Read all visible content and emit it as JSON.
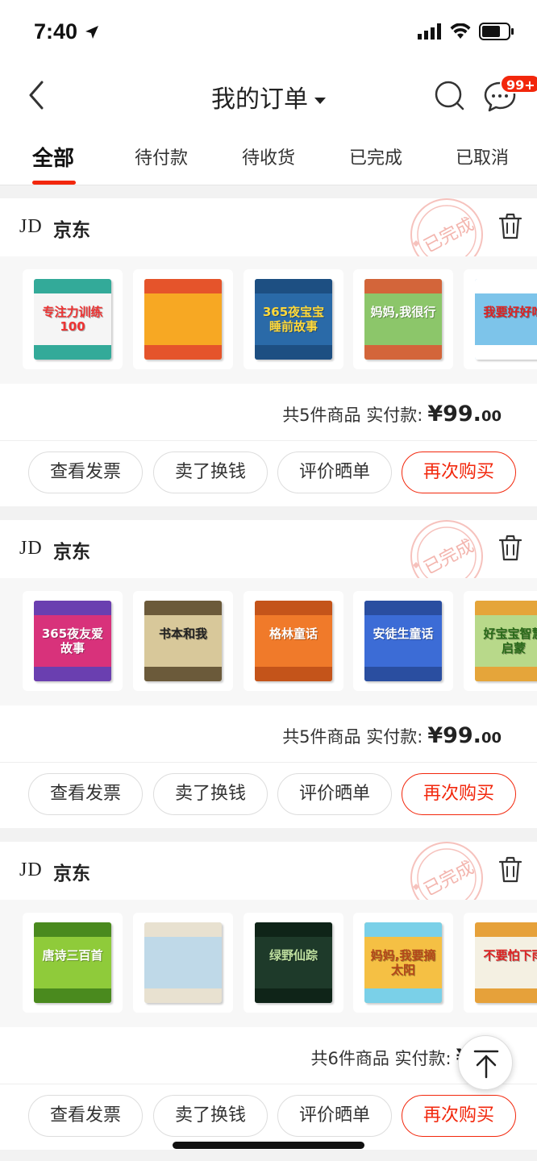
{
  "status_bar": {
    "time": "7:40"
  },
  "header": {
    "title": "我的订单",
    "badge": "99+"
  },
  "tabs": [
    {
      "label": "全部",
      "active": true
    },
    {
      "label": "待付款",
      "active": false
    },
    {
      "label": "待收货",
      "active": false
    },
    {
      "label": "已完成",
      "active": false
    },
    {
      "label": "已取消",
      "active": false
    }
  ],
  "orders": [
    {
      "shop_logo": "JD",
      "shop": "京东",
      "stamp": "已完成",
      "summary": "共5件商品 实付款:",
      "price_main": "¥99.",
      "price_cents": "00",
      "books": [
        {
          "title": "专注力训练100",
          "color": "#f5f5f5",
          "text_color": "#e33",
          "stripe": "#3a9"
        },
        {
          "title": "",
          "color": "#f7a823",
          "text_color": "#fff",
          "stripe": "#e5542b"
        },
        {
          "title": "365夜宝宝睡前故事",
          "color": "#2a6aa8",
          "text_color": "#ffd83a",
          "stripe": "#1d4f82"
        },
        {
          "title": "妈妈,我很行",
          "color": "#8cc66a",
          "text_color": "#fff",
          "stripe": "#d3653a"
        },
        {
          "title": "我要好好吃",
          "color": "#7dc4ea",
          "text_color": "#d22",
          "stripe": "#fff"
        }
      ],
      "buttons": [
        "查看发票",
        "卖了换钱",
        "评价晒单",
        "再次购买"
      ]
    },
    {
      "shop_logo": "JD",
      "shop": "京东",
      "stamp": "已完成",
      "summary": "共5件商品 实付款:",
      "price_main": "¥99.",
      "price_cents": "00",
      "books": [
        {
          "title": "365夜友爱故事",
          "color": "#d8327b",
          "text_color": "#fff",
          "stripe": "#6a3fb0"
        },
        {
          "title": "书本和我",
          "color": "#d8c89a",
          "text_color": "#222",
          "stripe": "#6b5a3a"
        },
        {
          "title": "格林童话",
          "color": "#f07a2a",
          "text_color": "#fff",
          "stripe": "#c4541a"
        },
        {
          "title": "安徒生童话",
          "color": "#3c6cd6",
          "text_color": "#fff",
          "stripe": "#2a4ea0"
        },
        {
          "title": "好宝宝智慧启蒙",
          "color": "#b8d98a",
          "text_color": "#2a6a1a",
          "stripe": "#e5a53a"
        }
      ],
      "buttons": [
        "查看发票",
        "卖了换钱",
        "评价晒单",
        "再次购买"
      ]
    },
    {
      "shop_logo": "JD",
      "shop": "京东",
      "stamp": "已完成",
      "summary": "共6件商品 实付款:",
      "price_main": "¥12",
      "price_cents": "",
      "books": [
        {
          "title": "唐诗三百首",
          "color": "#8fcb3a",
          "text_color": "#fff",
          "stripe": "#4a8a1e"
        },
        {
          "title": "",
          "color": "#bfd9e8",
          "text_color": "#444",
          "stripe": "#e8e1d0"
        },
        {
          "title": "绿野仙踪",
          "color": "#1e3a2a",
          "text_color": "#bfe0a0",
          "stripe": "#0f2418"
        },
        {
          "title": "妈妈,我要摘太阳",
          "color": "#f5c044",
          "text_color": "#b4471a",
          "stripe": "#7ad0e8"
        },
        {
          "title": "不要怕下雨",
          "color": "#f4f0e2",
          "text_color": "#d22",
          "stripe": "#e6a13a"
        }
      ],
      "buttons": [
        "查看发票",
        "卖了换钱",
        "评价晒单",
        "再次购买"
      ]
    }
  ],
  "icons": [
    "back-icon",
    "caret-down-icon",
    "search-icon",
    "message-icon",
    "trash-icon",
    "arrow-up-icon",
    "location-arrow-icon",
    "signal-icon",
    "wifi-icon",
    "battery-icon"
  ]
}
